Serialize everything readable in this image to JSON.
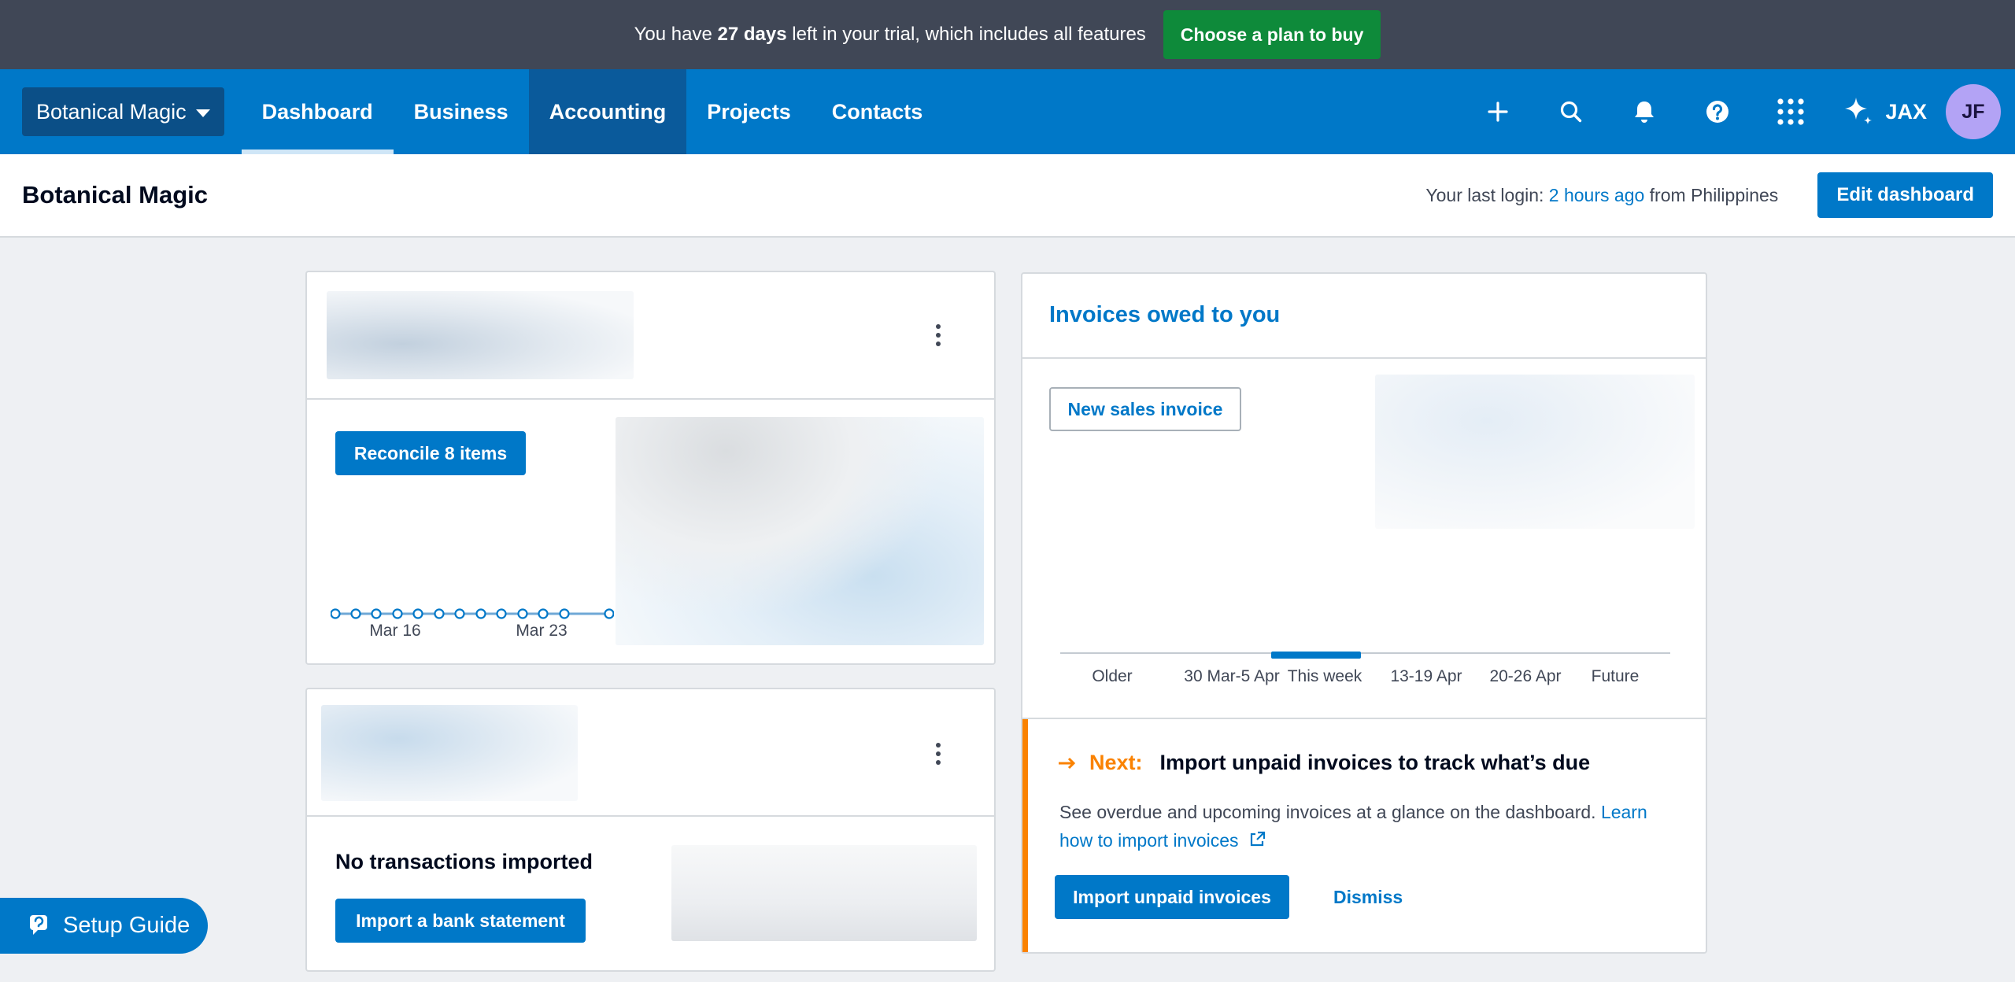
{
  "banner": {
    "text_prefix": "You have",
    "days": "27 days",
    "text_suffix": "left in your trial, which includes all features",
    "buy_label": "Choose a plan to buy"
  },
  "nav": {
    "org_name": "Botanical Magic",
    "links": [
      {
        "label": "Dashboard"
      },
      {
        "label": "Business"
      },
      {
        "label": "Accounting"
      },
      {
        "label": "Projects"
      },
      {
        "label": "Contacts"
      }
    ],
    "assistant_label": "JAX",
    "avatar_initials": "JF",
    "icons": [
      "plus-icon",
      "search-icon",
      "bell-icon",
      "help-icon",
      "apps-grid-icon",
      "sparkle-icon"
    ]
  },
  "subheader": {
    "title": "Botanical Magic",
    "login_prefix": "Your last login:",
    "login_time": "2 hours ago",
    "login_suffix": "from Philippines",
    "edit_label": "Edit dashboard"
  },
  "bank_card": {
    "reconcile_label": "Reconcile 8 items",
    "dates": [
      "Mar 16",
      "Mar 23"
    ]
  },
  "statement_card": {
    "empty_title": "No transactions imported",
    "import_label": "Import a bank statement"
  },
  "invoices_card": {
    "title": "Invoices owed to you",
    "new_invoice_label": "New sales invoice",
    "periods": [
      "Older",
      "30 Mar-5 Apr",
      "This week",
      "13-19 Apr",
      "20-26 Apr",
      "Future"
    ],
    "next": {
      "label": "Next:",
      "title": "Import unpaid invoices to track what’s due",
      "description": "See overdue and upcoming invoices at a glance on the dashboard.",
      "learn_link": "Learn how to import invoices",
      "import_label": "Import unpaid invoices",
      "dismiss_label": "Dismiss"
    }
  },
  "setup_guide": {
    "label": "Setup Guide"
  },
  "colors": {
    "brand_blue": "#0078c8",
    "nav_dark": "#0a5a9b",
    "banner_bg": "#404756",
    "buy_green": "#0e8a3a",
    "accent_orange": "#fa8200"
  }
}
